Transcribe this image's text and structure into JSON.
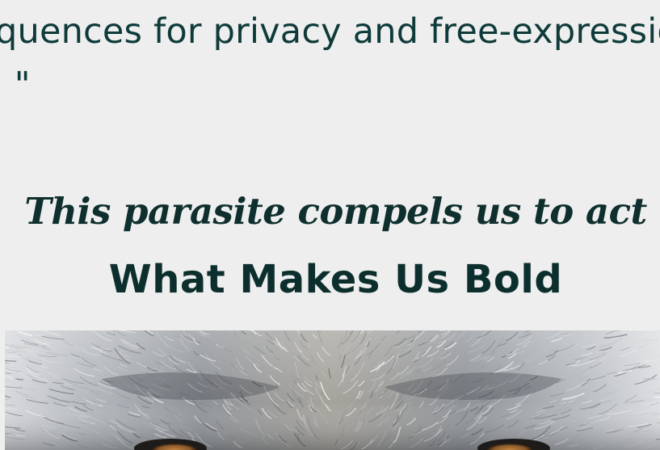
{
  "article": {
    "quote_line_1": "quences for privacy and free-expressio",
    "quote_line_2": ". \"",
    "subheading": "This parasite compels us to act",
    "heading": "What Makes Us Bold"
  },
  "hero_image": {
    "subject": "wolf-face-fur",
    "colors": {
      "fur_light": "#e6e8ea",
      "fur_mid": "#a7abb0",
      "fur_dark": "#4f5358",
      "eye": "#8a5a2b"
    }
  },
  "colors": {
    "background": "#eeeeee",
    "text_primary": "#0e3b3a",
    "text_heading": "#0c2f2d"
  }
}
